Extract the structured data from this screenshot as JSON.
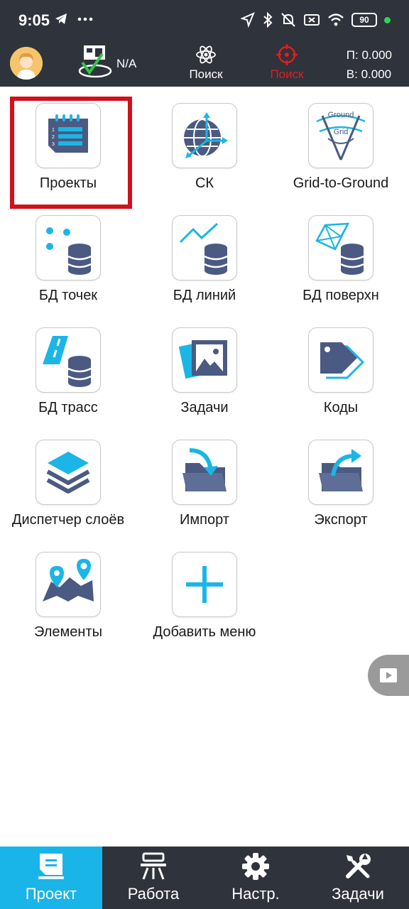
{
  "status_bar": {
    "time": "9:05",
    "battery": "90"
  },
  "header": {
    "rover_status": "N/A",
    "search_label_1": "Поиск",
    "search_label_2": "Поиск",
    "coord_p": "П: 0.000",
    "coord_v": "В: 0.000",
    "active_color": "#e01f1f"
  },
  "menu": {
    "items": [
      {
        "label": "Проекты",
        "icon": "projects-notebook-icon"
      },
      {
        "label": "СК",
        "icon": "coordinate-system-globe-icon"
      },
      {
        "label": "Grid-to-Ground",
        "icon": "grid-to-ground-icon"
      },
      {
        "label": "БД точек",
        "icon": "points-database-icon"
      },
      {
        "label": "БД линий",
        "icon": "lines-database-icon"
      },
      {
        "label": "БД поверхн",
        "icon": "surface-database-icon"
      },
      {
        "label": "БД трасс",
        "icon": "road-database-icon"
      },
      {
        "label": "Задачи",
        "icon": "tasks-picture-icon"
      },
      {
        "label": "Коды",
        "icon": "codes-tag-icon"
      },
      {
        "label": "Диспетчер слоёв",
        "icon": "layers-icon"
      },
      {
        "label": "Импорт",
        "icon": "import-folder-icon"
      },
      {
        "label": "Экспорт",
        "icon": "export-folder-icon"
      },
      {
        "label": "Элементы",
        "icon": "map-elements-icon"
      },
      {
        "label": "Добавить меню",
        "icon": "add-plus-icon"
      }
    ],
    "icon_text": {
      "ground": "Ground",
      "grid": "Grid"
    }
  },
  "bottom_nav": {
    "items": [
      {
        "label": "Проект",
        "active": true
      },
      {
        "label": "Работа",
        "active": false
      },
      {
        "label": "Настр.",
        "active": false
      },
      {
        "label": "Задачи",
        "active": false
      }
    ],
    "accent": "#19b4e8"
  }
}
